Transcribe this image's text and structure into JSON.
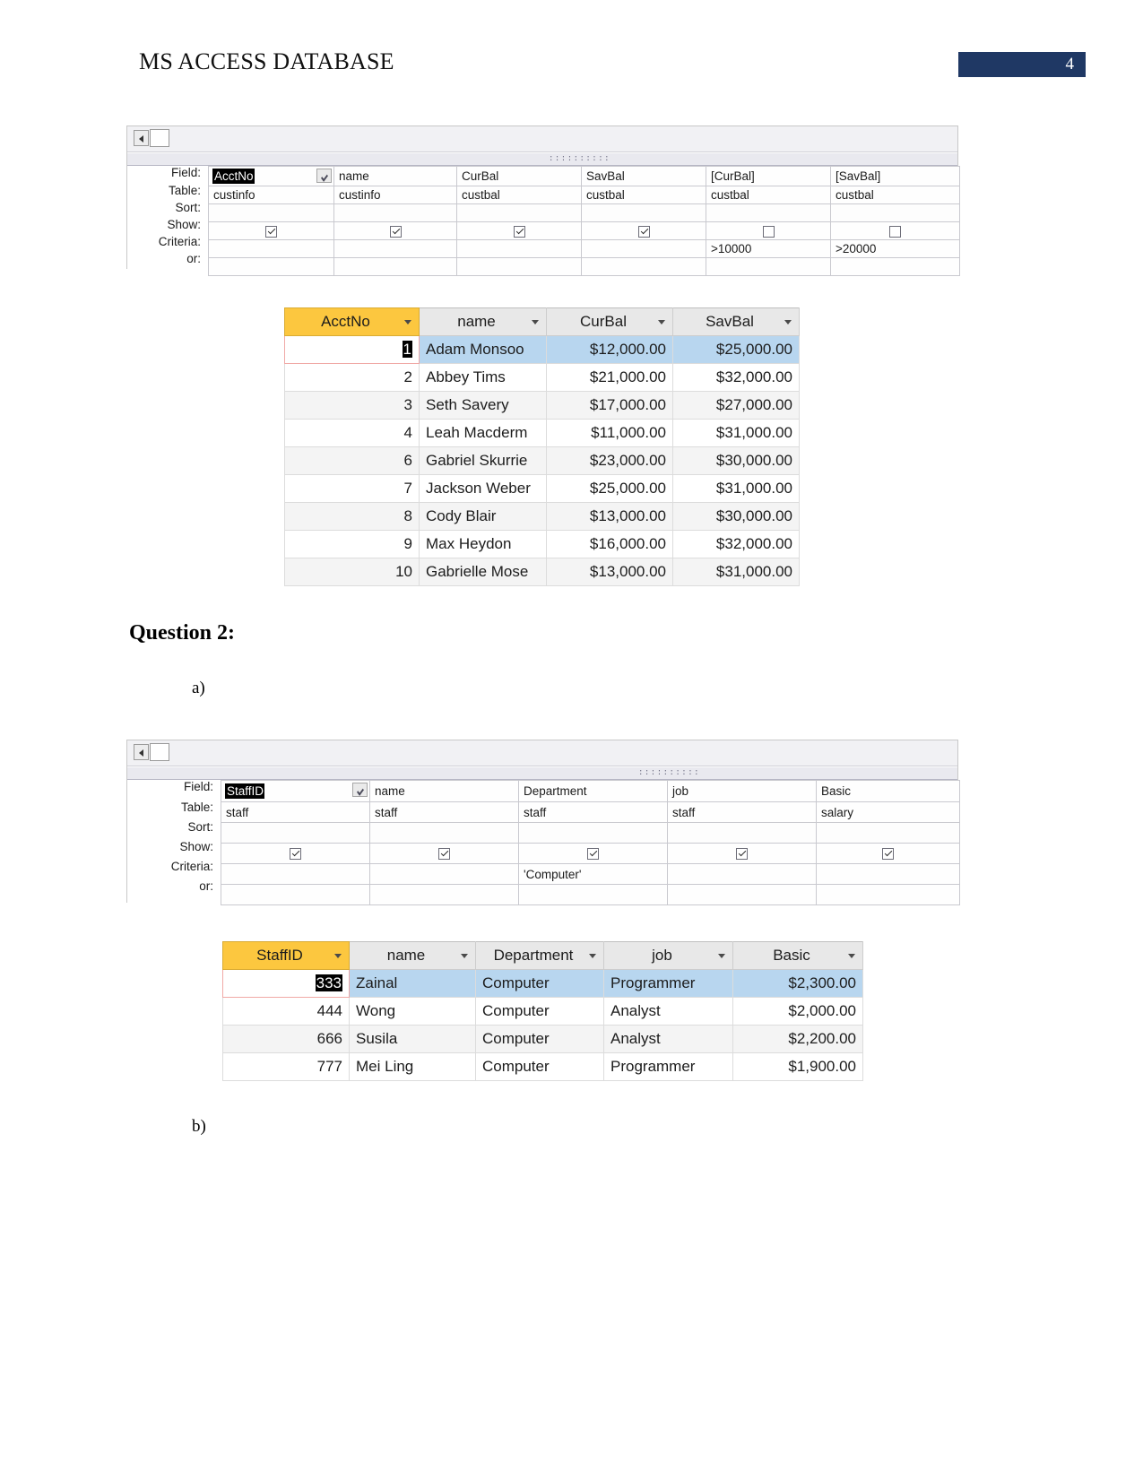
{
  "header": {
    "title": "MS ACCESS DATABASE",
    "page_number": "4",
    "badge_color": "#1f3864"
  },
  "query1": {
    "row_labels": [
      "Field:",
      "Table:",
      "Sort:",
      "Show:",
      "Criteria:",
      "or:"
    ],
    "columns": [
      {
        "field": "AcctNo",
        "table": "custinfo",
        "sort": "",
        "show": true,
        "criteria": "",
        "or": "",
        "selected": true
      },
      {
        "field": "name",
        "table": "custinfo",
        "sort": "",
        "show": true,
        "criteria": "",
        "or": "",
        "selected": false
      },
      {
        "field": "CurBal",
        "table": "custbal",
        "sort": "",
        "show": true,
        "criteria": "",
        "or": "",
        "selected": false
      },
      {
        "field": "SavBal",
        "table": "custbal",
        "sort": "",
        "show": true,
        "criteria": "",
        "or": "",
        "selected": false
      },
      {
        "field": "[CurBal]",
        "table": "custbal",
        "sort": "",
        "show": false,
        "criteria": ">10000",
        "or": "",
        "selected": false
      },
      {
        "field": "[SavBal]",
        "table": "custbal",
        "sort": "",
        "show": false,
        "criteria": ">20000",
        "or": "",
        "selected": false
      }
    ]
  },
  "datasheet1": {
    "columns": [
      {
        "label": "AcctNo",
        "key": true,
        "align": "num"
      },
      {
        "label": "name",
        "key": false,
        "align": "text"
      },
      {
        "label": "CurBal",
        "key": false,
        "align": "money"
      },
      {
        "label": "SavBal",
        "key": false,
        "align": "money"
      }
    ],
    "rows": [
      {
        "acctno": "1",
        "name": "Adam Monsoo",
        "curbal": "$12,000.00",
        "savbal": "$25,000.00",
        "selected": true,
        "editing": true
      },
      {
        "acctno": "2",
        "name": "Abbey Tims",
        "curbal": "$21,000.00",
        "savbal": "$32,000.00",
        "selected": false,
        "editing": false
      },
      {
        "acctno": "3",
        "name": "Seth Savery",
        "curbal": "$17,000.00",
        "savbal": "$27,000.00",
        "selected": false,
        "editing": false
      },
      {
        "acctno": "4",
        "name": "Leah Macderm",
        "curbal": "$11,000.00",
        "savbal": "$31,000.00",
        "selected": false,
        "editing": false
      },
      {
        "acctno": "6",
        "name": "Gabriel Skurrie",
        "curbal": "$23,000.00",
        "savbal": "$30,000.00",
        "selected": false,
        "editing": false
      },
      {
        "acctno": "7",
        "name": "Jackson Weber",
        "curbal": "$25,000.00",
        "savbal": "$31,000.00",
        "selected": false,
        "editing": false
      },
      {
        "acctno": "8",
        "name": "Cody Blair",
        "curbal": "$13,000.00",
        "savbal": "$30,000.00",
        "selected": false,
        "editing": false
      },
      {
        "acctno": "9",
        "name": "Max Heydon",
        "curbal": "$16,000.00",
        "savbal": "$32,000.00",
        "selected": false,
        "editing": false
      },
      {
        "acctno": "10",
        "name": "Gabrielle Mose",
        "curbal": "$13,000.00",
        "savbal": "$31,000.00",
        "selected": false,
        "editing": false
      }
    ]
  },
  "question2": {
    "heading": "Question 2:",
    "part_a": "a)",
    "part_b": "b)"
  },
  "query2": {
    "row_labels": [
      "Field:",
      "Table:",
      "Sort:",
      "Show:",
      "Criteria:",
      "or:"
    ],
    "columns": [
      {
        "field": "StaffID",
        "table": "staff",
        "sort": "",
        "show": true,
        "criteria": "",
        "or": "",
        "selected": true
      },
      {
        "field": "name",
        "table": "staff",
        "sort": "",
        "show": true,
        "criteria": "",
        "or": "",
        "selected": false
      },
      {
        "field": "Department",
        "table": "staff",
        "sort": "",
        "show": true,
        "criteria": "'Computer'",
        "or": "",
        "selected": false
      },
      {
        "field": "job",
        "table": "staff",
        "sort": "",
        "show": true,
        "criteria": "",
        "or": "",
        "selected": false
      },
      {
        "field": "Basic",
        "table": "salary",
        "sort": "",
        "show": true,
        "criteria": "",
        "or": "",
        "selected": false
      }
    ]
  },
  "datasheet2": {
    "columns": [
      {
        "label": "StaffID",
        "key": true,
        "align": "num"
      },
      {
        "label": "name",
        "key": false,
        "align": "text"
      },
      {
        "label": "Department",
        "key": false,
        "align": "text"
      },
      {
        "label": "job",
        "key": false,
        "align": "text"
      },
      {
        "label": "Basic",
        "key": false,
        "align": "money"
      }
    ],
    "rows": [
      {
        "staffid": "333",
        "name": "Zainal",
        "department": "Computer",
        "job": "Programmer",
        "basic": "$2,300.00",
        "selected": true,
        "editing": true
      },
      {
        "staffid": "444",
        "name": "Wong",
        "department": "Computer",
        "job": "Analyst",
        "basic": "$2,000.00",
        "selected": false,
        "editing": false
      },
      {
        "staffid": "666",
        "name": "Susila",
        "department": "Computer",
        "job": "Analyst",
        "basic": "$2,200.00",
        "selected": false,
        "editing": false
      },
      {
        "staffid": "777",
        "name": "Mei Ling",
        "department": "Computer",
        "job": "Programmer",
        "basic": "$1,900.00",
        "selected": false,
        "editing": false
      }
    ]
  }
}
